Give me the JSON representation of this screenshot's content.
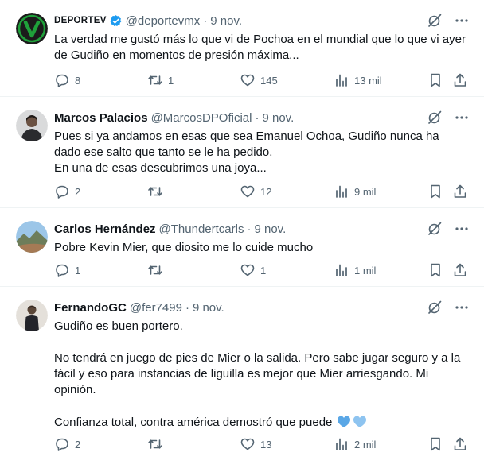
{
  "colors": {
    "text": "#0f1419",
    "muted": "#536471",
    "divider": "#eff3f4",
    "verified": "#1d9bf0",
    "brand_green": "#1fa13a",
    "heart_emoji": "#5aa7e6"
  },
  "icons": {
    "verified": "verified-badge-icon",
    "grok": "grok-icon",
    "more": "more-icon",
    "reply": "reply-icon",
    "retweet": "retweet-icon",
    "like": "like-icon",
    "views": "views-icon",
    "bookmark": "bookmark-icon",
    "share": "share-icon",
    "emoji": "light-blue-heart-emoji"
  },
  "tweets": [
    {
      "name": "DEPORTEV",
      "handle": "@deportevmx",
      "separator": "·",
      "date": "9 nov.",
      "lines": [
        "La verdad me gustó más lo que vi de Pochoa en el mundial que lo que vi ayer de Gudiño en momentos de presión máxima..."
      ],
      "replies": "8",
      "retweets": "1",
      "likes": "145",
      "views": "13 mil"
    },
    {
      "name": "Marcos Palacios",
      "handle": "@MarcosDPOficial",
      "separator": "·",
      "date": "9 nov.",
      "lines": [
        "Pues si ya andamos en esas que sea Emanuel Ochoa, Gudiño nunca ha dado ese salto que tanto se le ha pedido.",
        "En una de esas descubrimos una joya..."
      ],
      "replies": "2",
      "retweets": "",
      "likes": "12",
      "views": "9 mil"
    },
    {
      "name": "Carlos Hernández",
      "handle": "@Thundertcarls",
      "separator": "·",
      "date": "9 nov.",
      "lines": [
        "Pobre Kevin Mier, que diosito me lo cuide mucho"
      ],
      "replies": "1",
      "retweets": "",
      "likes": "1",
      "views": "1 mil"
    },
    {
      "name": "FernandoGC",
      "handle": "@fer7499",
      "separator": "·",
      "date": "9 nov.",
      "lines": [
        "Gudiño es buen portero.",
        "",
        "No tendrá en juego de pies de Mier o la salida. Pero sabe jugar seguro y a la fácil y eso para instancias de liguilla es mejor que Mier arriesgando. Mi opinión.",
        "",
        "Confianza total, contra américa demostró que puede"
      ],
      "replies": "2",
      "retweets": "",
      "likes": "13",
      "views": "2 mil"
    }
  ]
}
